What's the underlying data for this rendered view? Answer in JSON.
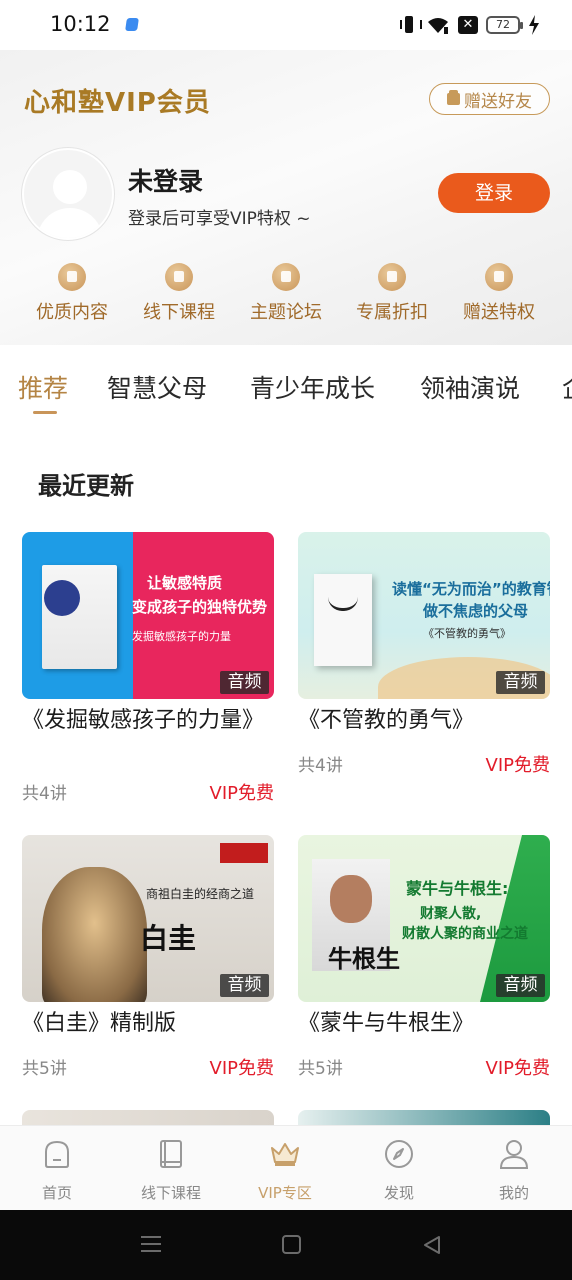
{
  "status_bar": {
    "time": "10:12",
    "battery": "72"
  },
  "header": {
    "title": "心和塾VIP会员",
    "gift_button": "赠送好友",
    "user_name": "未登录",
    "user_subtitle": "登录后可享受VIP特权 ~",
    "login_button": "登录"
  },
  "perks": [
    {
      "label": "优质内容",
      "icon": "document-icon"
    },
    {
      "label": "线下课程",
      "icon": "paper-plane-icon"
    },
    {
      "label": "主题论坛",
      "icon": "chat-bubble-icon"
    },
    {
      "label": "专属折扣",
      "icon": "discount-tag-icon"
    },
    {
      "label": "赠送特权",
      "icon": "gift-box-icon"
    }
  ],
  "category_tabs": [
    "推荐",
    "智慧父母",
    "青少年成长",
    "领袖演说",
    "企"
  ],
  "active_tab": "推荐",
  "section_title": "最近更新",
  "cards": [
    {
      "title": "《发掘敏感孩子的力量》",
      "tag": "音频",
      "lessons": "共4讲",
      "price": "VIP免费",
      "cover_lines": [
        "让敏感特质",
        "变成孩子的独特优势",
        "发掘敏感孩子的力量"
      ]
    },
    {
      "title": "《不管教的勇气》",
      "tag": "音频",
      "lessons": "共4讲",
      "price": "VIP免费",
      "cover_lines": [
        "读懂“无为而治”的教育智慧",
        "做不焦虑的父母",
        "《不管教的勇气》"
      ]
    },
    {
      "title": "《白圭》精制版",
      "tag": "音频",
      "lessons": "共5讲",
      "price": "VIP免费",
      "cover_lines": [
        "商祖白圭的经商之道",
        "白圭"
      ]
    },
    {
      "title": "《蒙牛与牛根生》",
      "tag": "音频",
      "lessons": "共5讲",
      "price": "VIP免费",
      "cover_lines": [
        "蒙牛与牛根生:",
        "财聚人散,",
        "财散人聚的商业之道",
        "牛根生"
      ]
    }
  ],
  "bottom_nav": [
    {
      "label": "首页",
      "icon": "home-icon"
    },
    {
      "label": "线下课程",
      "icon": "book-icon"
    },
    {
      "label": "VIP专区",
      "icon": "crown-icon"
    },
    {
      "label": "发现",
      "icon": "compass-icon"
    },
    {
      "label": "我的",
      "icon": "person-icon"
    }
  ],
  "active_nav": "VIP专区",
  "colors": {
    "accent_gold": "#a97a25",
    "login_orange": "#ea5a1c",
    "vip_red": "#e21c2a"
  }
}
